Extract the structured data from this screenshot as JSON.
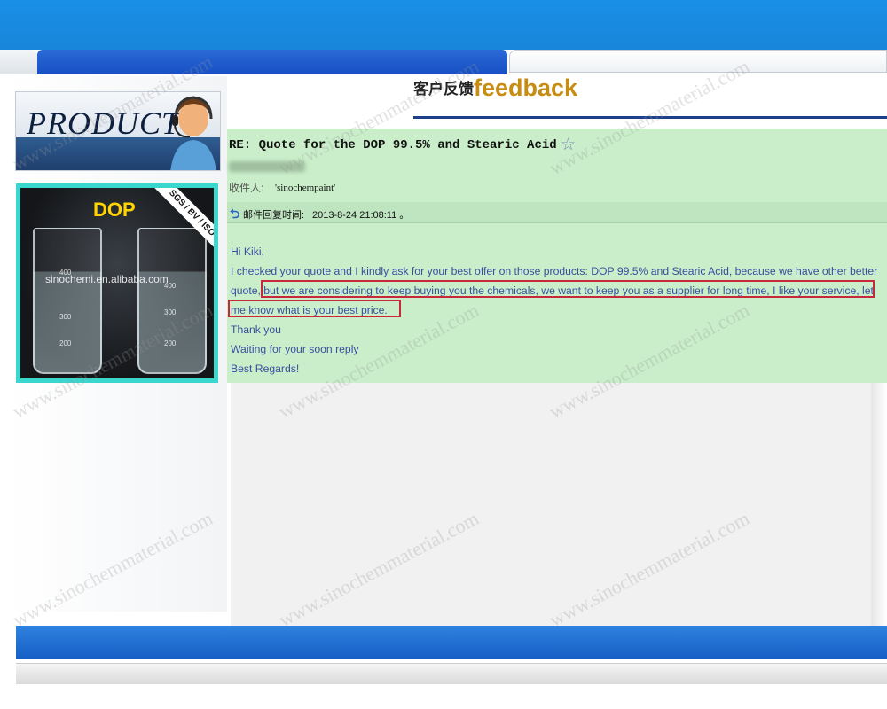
{
  "header": {
    "feedback_cn": "客户反馈",
    "feedback_en": "feedback"
  },
  "sidebar": {
    "product_title": "PRODUCT",
    "photo": {
      "label": "DOP",
      "cert": "SGS / BV / ISO",
      "watermark": "sinochemi.en.alibaba.com",
      "ticks": [
        "400",
        "300",
        "200"
      ]
    }
  },
  "email": {
    "subject": "RE: Quote for the DOP 99.5% and Stearic Acid",
    "recipient_label": "收件人:",
    "recipient_value": "'sinochempaint'",
    "reply_label": "邮件回复时间:",
    "reply_time": "2013-8-24 21:08:11 。",
    "body_lines": [
      "Hi Kiki,",
      "I checked your quote and I kindly ask for your best offer on those products: DOP 99.5% and Stearic Acid, because we have other better",
      "quote, but we are considering to keep buying you the chemicals, we want to keep you as a supplier for long time, I like your service, let",
      "me know what is your best price.",
      "Thank you",
      "Waiting for your soon reply",
      "Best Regards!"
    ]
  },
  "watermark_text": "www.sinochemmaterial.com",
  "colors": {
    "accent_blue": "#1786db",
    "email_bg": "#c9eec9",
    "feedback_gold": "#c68d12",
    "highlight_red": "#c8283a"
  }
}
